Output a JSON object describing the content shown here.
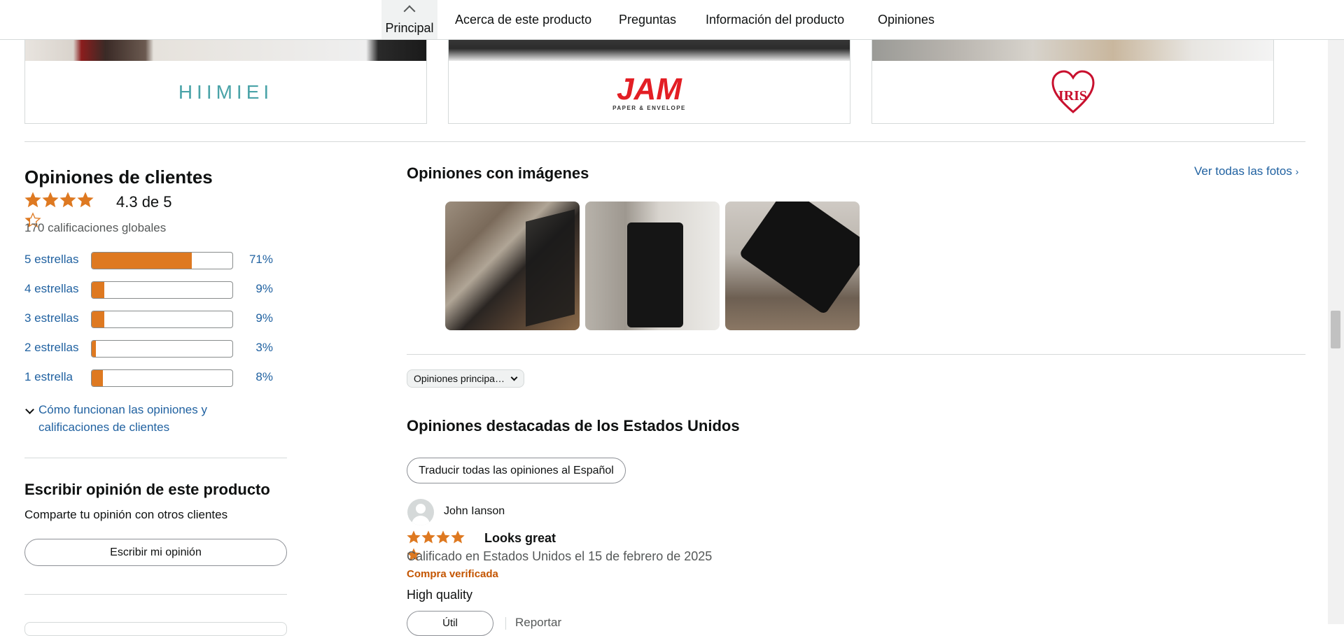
{
  "nav": {
    "active": "Principal",
    "items": [
      "Acerca de este producto",
      "Preguntas",
      "Información del producto",
      "Opiniones"
    ]
  },
  "brands": [
    {
      "logo_text": "HIIMIEI"
    },
    {
      "logo_text": "JAM",
      "logo_sub": "PAPER & ENVELOPE"
    },
    {
      "logo_text": "IRIS"
    }
  ],
  "reviews_summary": {
    "title": "Opiniones de clientes",
    "rating_text": "4.3 de 5",
    "rating_value": 4.3,
    "global_count": "170 calificaciones globales",
    "histogram": [
      {
        "label": "5 estrellas",
        "pct": "71%",
        "value": 71
      },
      {
        "label": "4 estrellas",
        "pct": "9%",
        "value": 9
      },
      {
        "label": "3 estrellas",
        "pct": "9%",
        "value": 9
      },
      {
        "label": "2 estrellas",
        "pct": "3%",
        "value": 3
      },
      {
        "label": "1 estrella",
        "pct": "8%",
        "value": 8
      }
    ],
    "how_it_works": "Cómo funcionan las opiniones y calificaciones de clientes"
  },
  "write_review": {
    "title": "Escribir opinión de este producto",
    "subtitle": "Comparte tu opinión con otros clientes",
    "button": "Escribir mi opinión"
  },
  "images_section": {
    "title": "Opiniones con imágenes",
    "see_all": "Ver todas las fotos"
  },
  "sort": {
    "selected": "Opiniones principa…"
  },
  "featured": {
    "title": "Opiniones destacadas de los Estados Unidos",
    "translate_button": "Traducir todas las opiniones al Español"
  },
  "review": {
    "author": "John Ianson",
    "rating": 5,
    "headline": "Looks great",
    "meta": "Calificado en Estados Unidos el 15 de febrero de 2025",
    "verified": "Compra verificada",
    "body": "High quality",
    "helpful_button": "Útil",
    "report": "Reportar"
  },
  "colors": {
    "accent_orange": "#de7921",
    "link_blue": "#2162a1",
    "verified_orange": "#c45500",
    "jam_red": "#e31e24",
    "iris_red": "#c8102e",
    "himiei_teal": "#4aa3a8"
  }
}
